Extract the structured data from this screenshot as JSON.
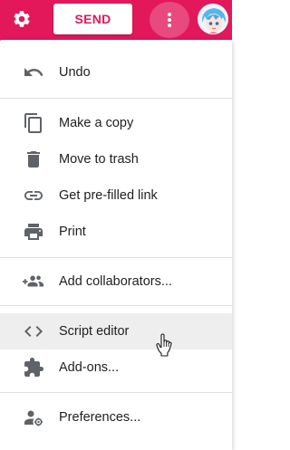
{
  "toolbar": {
    "settings_icon": "gear-icon",
    "send_label": "SEND",
    "more_icon": "more-vert-icon",
    "accent_color": "#e2185b"
  },
  "menu": {
    "items": [
      {
        "label": "Undo",
        "icon": "undo-icon"
      },
      {
        "label": "Make a copy",
        "icon": "copy-icon"
      },
      {
        "label": "Move to trash",
        "icon": "trash-icon"
      },
      {
        "label": "Get pre-filled link",
        "icon": "link-icon"
      },
      {
        "label": "Print",
        "icon": "print-icon"
      },
      {
        "label": "Add collaborators...",
        "icon": "add-people-icon"
      },
      {
        "label": "Script editor",
        "icon": "code-icon",
        "hovered": true
      },
      {
        "label": "Add-ons...",
        "icon": "puzzle-icon"
      },
      {
        "label": "Preferences...",
        "icon": "person-settings-icon"
      }
    ]
  }
}
